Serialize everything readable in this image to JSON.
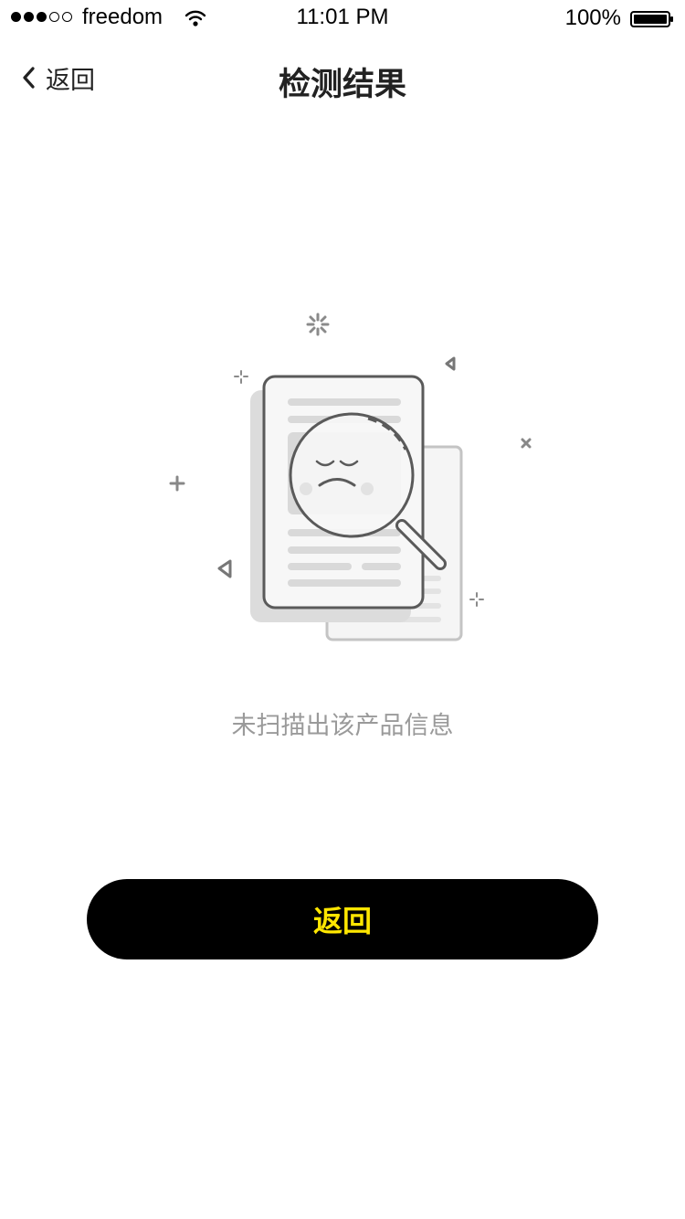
{
  "status_bar": {
    "carrier": "freedom",
    "time": "11:01 PM",
    "battery_percent": "100%",
    "signal_bars_filled": 3,
    "signal_bars_total": 5
  },
  "nav": {
    "back_label": "返回",
    "title": "检测结果"
  },
  "illustration": {
    "icon": "document-magnifier-sad-face"
  },
  "empty_state": {
    "message": "未扫描出该产品信息"
  },
  "actions": {
    "return_label": "返回"
  },
  "colors": {
    "button_bg": "#000000",
    "button_text": "#ffe600",
    "message_text": "#9a9a9a"
  }
}
